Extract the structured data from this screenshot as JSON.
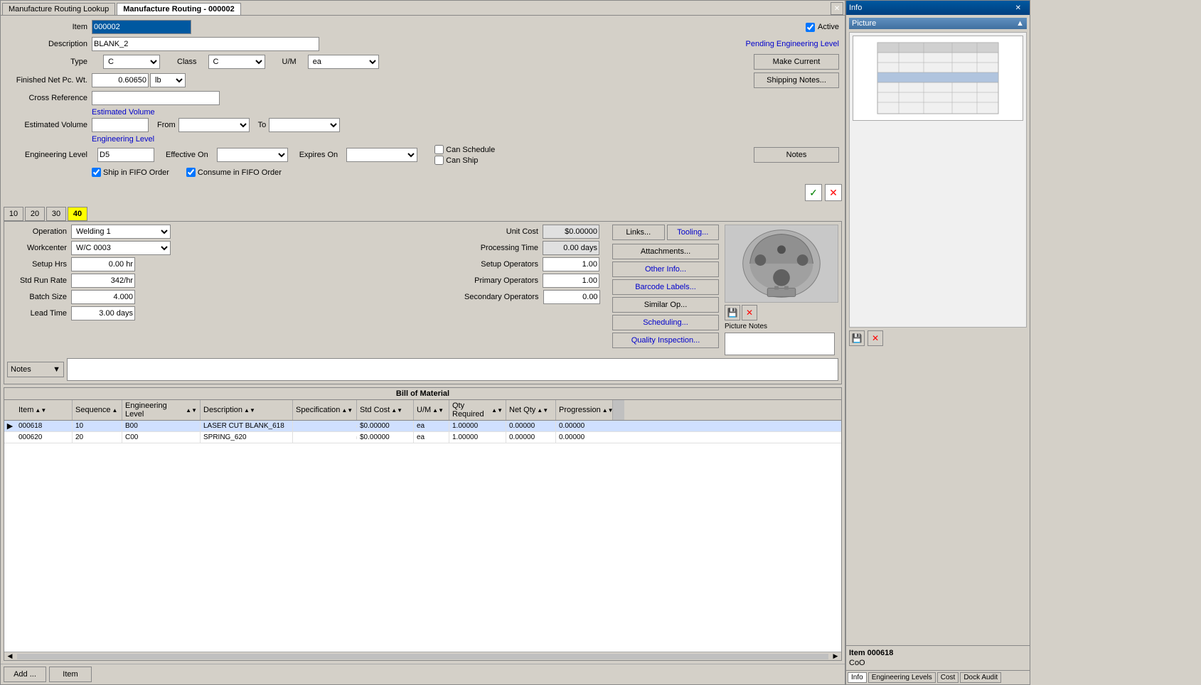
{
  "window": {
    "title_inactive": "Manufacture Routing Lookup",
    "title_active": "Manufacture Routing - 000002",
    "close_char": "✕"
  },
  "header": {
    "item_label": "Item",
    "item_value": "000002",
    "description_label": "Description",
    "description_value": "BLANK_2",
    "type_label": "Type",
    "type_value": "C",
    "class_label": "Class",
    "class_value": "C",
    "um_label": "U/M",
    "um_value": "ea",
    "finished_label": "Finished Net Pc. Wt.",
    "finished_value": "0.60650",
    "weight_unit": "lb",
    "cross_ref_label": "Cross Reference",
    "cross_ref_value": "",
    "active_label": "Active",
    "active_checked": true,
    "pending_eng": "Pending Engineering Level",
    "make_current": "Make Current",
    "shipping_notes": "Shipping Notes...",
    "estimated_volume_link": "Estimated Volume",
    "estimated_volume_label": "Estimated Volume",
    "from_label": "From",
    "to_label": "To",
    "from_value": "",
    "to_value": "",
    "estimated_volume_value": "",
    "engineering_level_link": "Engineering Level",
    "eng_level_label": "Engineering Level",
    "eng_level_value": "D5",
    "effective_on_label": "Effective On",
    "effective_on_value": "",
    "expires_on_label": "Expires On",
    "expires_on_value": "",
    "can_schedule_label": "Can Schedule",
    "can_ship_label": "Can Ship",
    "can_schedule_checked": false,
    "can_ship_checked": false,
    "notes_btn": "Notes",
    "ship_fifo": "Ship in FIFO Order",
    "consume_fifo": "Consume in FIFO Order",
    "ship_fifo_checked": true,
    "consume_fifo_checked": true
  },
  "action_buttons": {
    "check": "✓",
    "cross": "✕"
  },
  "num_tabs": [
    "10",
    "20",
    "30",
    "40"
  ],
  "active_num_tab": "40",
  "operation": {
    "operation_label": "Operation",
    "operation_value": "Welding 1",
    "workcenter_label": "Workcenter",
    "workcenter_value": "W/C 0003",
    "setup_hrs_label": "Setup Hrs",
    "setup_hrs_value": "0.00 hr",
    "std_run_label": "Std Run Rate",
    "std_run_value": "342/hr",
    "batch_label": "Batch Size",
    "batch_value": "4.000",
    "lead_label": "Lead Time",
    "lead_value": "3.00 days",
    "unit_cost_label": "Unit Cost",
    "unit_cost_value": "$0.00000",
    "processing_label": "Processing Time",
    "processing_value": "0.00 days",
    "setup_ops_label": "Setup Operators",
    "setup_ops_value": "1.00",
    "primary_ops_label": "Primary Operators",
    "primary_ops_value": "1.00",
    "secondary_ops_label": "Secondary Operators",
    "secondary_ops_value": "0.00",
    "links_btn": "Links...",
    "tooling_btn": "Tooling...",
    "attachments_btn": "Attachments...",
    "other_info_btn": "Other Info...",
    "barcode_btn": "Barcode Labels...",
    "similar_op_btn": "Similar Op...",
    "scheduling_btn": "Scheduling...",
    "quality_btn": "Quality Inspection...",
    "notes_btn": "Notes",
    "picture_notes_label": "Picture Notes",
    "picture_notes_value": ""
  },
  "bom": {
    "title": "Bill of Material",
    "columns": [
      {
        "label": "Item",
        "key": "item"
      },
      {
        "label": "Sequence",
        "key": "seq"
      },
      {
        "label": "Engineering Level",
        "key": "eng"
      },
      {
        "label": "Description",
        "key": "desc"
      },
      {
        "label": "Specification",
        "key": "spec"
      },
      {
        "label": "Std Cost",
        "key": "cost"
      },
      {
        "label": "U/M",
        "key": "um"
      },
      {
        "label": "Qty Required",
        "key": "qty"
      },
      {
        "label": "Net Qty",
        "key": "netqty"
      },
      {
        "label": "Progression",
        "key": "prog"
      }
    ],
    "rows": [
      {
        "item": "000618",
        "seq": "10",
        "eng": "B00",
        "desc": "LASER CUT BLANK_618",
        "spec": "",
        "cost": "$0.00000",
        "um": "ea",
        "qty": "1.00000",
        "netqty": "0.00000",
        "prog": "0.00000",
        "selected": true
      },
      {
        "item": "000620",
        "seq": "20",
        "eng": "C00",
        "desc": "SPRING_620",
        "spec": "",
        "cost": "$0.00000",
        "um": "ea",
        "qty": "1.00000",
        "netqty": "0.00000",
        "prog": "0.00000",
        "selected": false
      }
    ],
    "add_btn": "Add ...",
    "item_btn": "Item"
  },
  "info_panel": {
    "title": "Info",
    "close_char": "✕",
    "picture_section": "Picture",
    "collapse_char": "▲",
    "bottom_tabs": [
      "Info",
      "Engineering Levels",
      "Cost",
      "Dock Audit"
    ]
  },
  "item_detail": {
    "label": "Item 000618",
    "coo_label": "CoO"
  }
}
